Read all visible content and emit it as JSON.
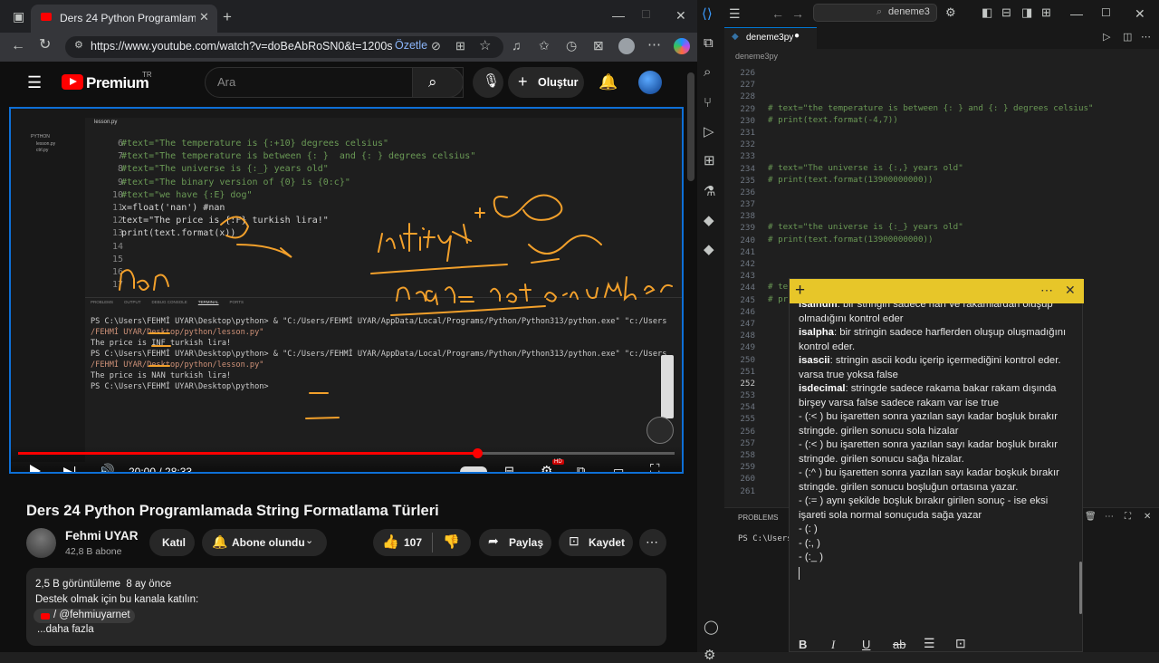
{
  "browser": {
    "tab_title": "Ders 24 Python Programlamada S",
    "url": "https://www.youtube.com/watch?v=doBeAbRoSN0&t=1200s",
    "summarize_label": "Özetle"
  },
  "youtube": {
    "brand": "Premium",
    "region": "TR",
    "search_placeholder": "Ara",
    "create_label": "Oluştur",
    "video_title": "Ders 24 Python Programlamada String Formatlama Türleri",
    "channel_name": "Fehmi UYAR",
    "subscribers": "42,8 B abone",
    "join_label": "Katıl",
    "subscribed_label": "Abone olundu",
    "likes": "107",
    "share_label": "Paylaş",
    "save_label": "Kaydet",
    "description": {
      "stats": "2,5 B görüntüleme  8 ay önce",
      "line1": "Destek olmak için bu kanala katılın:",
      "link": "/ @fehmiuyarnet",
      "more": "...daha fazla"
    },
    "player": {
      "time": "20:00 / 28:33",
      "progress": 0.7
    }
  },
  "video_content": {
    "tab_file": "lesson.py",
    "editor_lines": [
      {
        "n": "6",
        "t": "#text=\"The temperature is {:+10} degrees celsius\""
      },
      {
        "n": "7",
        "t": "#text=\"The temperature is between {: }  and {: } degrees celsius\""
      },
      {
        "n": "8",
        "t": "#text=\"The universe is {:_} years old\""
      },
      {
        "n": "9",
        "t": "#text=\"The binary version of {0} is {0:c}\""
      },
      {
        "n": "10",
        "t": "#text=\"we have {:E} dog\""
      },
      {
        "n": "11",
        "t": "x=float('nan') #nan"
      },
      {
        "n": "12",
        "t": "text=\"The price is {:F} turkish lira!\""
      },
      {
        "n": "13",
        "t": "print(text.format(x))"
      },
      {
        "n": "14",
        "t": ""
      },
      {
        "n": "15",
        "t": ""
      },
      {
        "n": "16",
        "t": ""
      },
      {
        "n": "17",
        "t": ""
      }
    ],
    "panel_tabs": [
      "PROBLEMS",
      "OUTPUT",
      "DEBUG CONSOLE",
      "TERMINAL",
      "PORTS"
    ],
    "terminal_lines": [
      "PS C:\\Users\\FEHMİ UYAR\\Desktop\\python> & \"C:/Users/FEHMİ UYAR/AppData/Local/Programs/Python/Python313/python.exe\" \"c:/Users",
      "/FEHMİ UYAR/Desktop/python/lesson.py\"",
      "The price is INF turkish lira!",
      "PS C:\\Users\\FEHMİ UYAR\\Desktop\\python> & \"C:/Users/FEHMİ UYAR/AppData/Local/Programs/Python/Python313/python.exe\" \"c:/Users",
      "/FEHMİ UYAR/Desktop/python/lesson.py\"",
      "The price is NAN turkish lira!",
      "PS C:\\Users\\FEHMİ UYAR\\Desktop\\python> "
    ]
  },
  "vscode": {
    "search_text": "deneme3",
    "tab_name": "deneme3py",
    "breadcrumb": "deneme3py",
    "lines": [
      {
        "n": "226",
        "t": ""
      },
      {
        "n": "227",
        "t": ""
      },
      {
        "n": "228",
        "t": ""
      },
      {
        "n": "229",
        "t": "# text=\"the temperature is between {: } and {: } degrees celsius\""
      },
      {
        "n": "230",
        "t": "# print(text.format(-4,7))"
      },
      {
        "n": "231",
        "t": ""
      },
      {
        "n": "232",
        "t": ""
      },
      {
        "n": "233",
        "t": ""
      },
      {
        "n": "234",
        "t": "# text=\"The universe is {:,} years old\""
      },
      {
        "n": "235",
        "t": "# print(text.format(13900000000))"
      },
      {
        "n": "236",
        "t": ""
      },
      {
        "n": "237",
        "t": ""
      },
      {
        "n": "238",
        "t": ""
      },
      {
        "n": "239",
        "t": "# text=\"the universe is {:_} years old\""
      },
      {
        "n": "240",
        "t": "# print(text.format(13900000000))"
      },
      {
        "n": "241",
        "t": ""
      },
      {
        "n": "242",
        "t": ""
      },
      {
        "n": "243",
        "t": ""
      },
      {
        "n": "244",
        "t": "# te"
      },
      {
        "n": "245",
        "t": "# pr"
      },
      {
        "n": "246",
        "t": ""
      },
      {
        "n": "247",
        "t": ""
      },
      {
        "n": "248",
        "t": ""
      },
      {
        "n": "249",
        "t": ""
      },
      {
        "n": "250",
        "t": ""
      },
      {
        "n": "251",
        "t": ""
      },
      {
        "n": "252",
        "t": ""
      },
      {
        "n": "253",
        "t": ""
      },
      {
        "n": "254",
        "t": ""
      },
      {
        "n": "255",
        "t": ""
      },
      {
        "n": "256",
        "t": ""
      },
      {
        "n": "257",
        "t": ""
      },
      {
        "n": "258",
        "t": ""
      },
      {
        "n": "259",
        "t": ""
      },
      {
        "n": "260",
        "t": ""
      },
      {
        "n": "261",
        "t": ""
      }
    ],
    "panel_label": "PROBLEMS",
    "terminal_prompt": "PS C:\\Users"
  },
  "sticky_note": {
    "items": [
      {
        "k": "isalnum",
        "v": ": bir stringin sadece harf ve rakamlardan oluşup olmadığını kontrol eder"
      },
      {
        "k": "isalpha",
        "v": ": bir stringin sadece harflerden oluşup oluşmadığını kontrol eder."
      },
      {
        "k": "isascii",
        "v": ": stringin ascii kodu içerip içermediğini kontrol eder. varsa true yoksa false"
      },
      {
        "k": "isdecimal",
        "v": ": stringde sadece rakama bakar rakam dışında birşey varsa false sadece rakam var ise true"
      }
    ],
    "plain": [
      "- (:< ) bu işaretten sonra yazılan sayı kadar boşluk bırakır stringde. girilen sonucu sola hizalar",
      "- (:< ) bu işaretten sonra yazılan sayı kadar boşluk bırakır stringde. girilen sonucu sağa hizalar.",
      "- (:^ ) bu işaretten sonra yazılan sayı kadar boşkuk bırakır stringde. girilen sonucu boşluğun ortasına yazar.",
      "- (:= ) aynı şekilde boşluk bırakır girilen sonuç - ise eksi işareti sola normal sonuçuda sağa yazar",
      "- (: )",
      "- (:, )",
      "- (:_ )"
    ]
  }
}
